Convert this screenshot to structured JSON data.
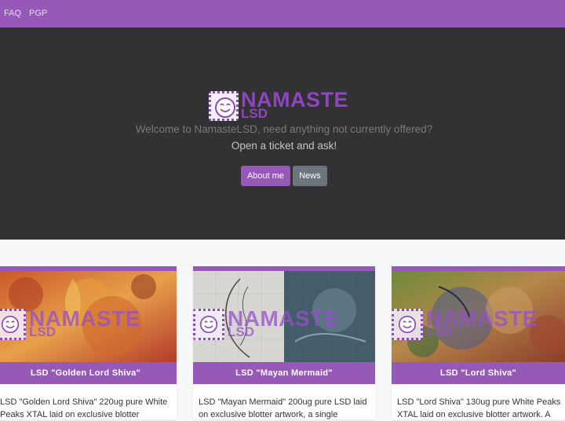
{
  "nav": {
    "faq": "FAQ",
    "pgp": "PGP"
  },
  "hero": {
    "logo_word1": "NAMASTE",
    "logo_word2": "LSD",
    "tagline_line1": "Welcome to NamasteLSD, need anything not currently offered?",
    "tagline_line2": "Open a ticket and ask!",
    "about_label": "About me",
    "news_label": "News"
  },
  "products": [
    {
      "title": "LSD \"Golden Lord Shiva\"",
      "description": "LSD \"Golden Lord Shiva\" 220ug pure White Peaks XTAL laid on exclusive blotter"
    },
    {
      "title": "LSD \"Mayan Mermaid\"",
      "description": "LSD \"Mayan Mermaid\" 200ug pure LSD laid on exclusive blotter artwork, a single"
    },
    {
      "title": "LSD \"Lord Shiva\"",
      "description": "LSD \"Lord Shiva\" 130ug pure White Peaks XTAL laid on exclusive blotter artwork. A"
    }
  ],
  "watermark": {
    "word1": "NAMASTE",
    "word2": "LSD"
  },
  "colors": {
    "accent": "#9659b8",
    "hero_bg": "#323133",
    "logo_purple": "#8d46bf"
  }
}
